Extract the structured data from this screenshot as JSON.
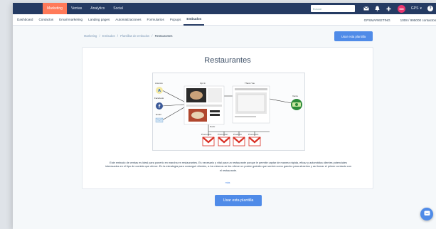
{
  "topnav": {
    "items": [
      "Marketing",
      "Ventas",
      "Analytics",
      "Social"
    ],
    "search_placeholder": "Buscar",
    "avatar_initials": "GM",
    "account_label": "GPS",
    "account_caret": "▾",
    "help_label": "?"
  },
  "subnav": {
    "items": [
      "Dashboard",
      "Contactos",
      "Email marketing",
      "Landing pages",
      "Automatizaciones",
      "Formularios",
      "Popups",
      "Embudos"
    ],
    "account_name": "GPSMARKETING",
    "contacts_count": "1008 / 995000 contactos"
  },
  "breadcrumb": {
    "items": [
      "Marketing",
      "Embudos",
      "Plantillas de embudos"
    ],
    "separator": "/",
    "current": "Restaurantes"
  },
  "use_template_top_label": "Usar esta plantilla",
  "page_title": "Restaurantes",
  "diagram": {
    "source_labels": [
      "Anuncio",
      "Facebook",
      "Email"
    ],
    "optin_label": "Opt In",
    "thankyou_label": "Thank You",
    "sale_label": "Venta",
    "nurture_label": "Nutrir",
    "email_labels": [
      "Promoción",
      "Promoción",
      "Producto",
      "Promoción"
    ]
  },
  "description": "Este embudo de ventas es ideal para ponerlo en marcha en restaurantes. Es necesario y vital para un restaurante porque le permite captar de manera rápida, eficaz y automática clientes potenciales interesados en el tipo de comida que ofrece. En la estrategia para conseguir clientes, a los mismos se les ofrece un postre gratuito que servirá como gancho para atraerlos y así tomar el primer contacto con el restaurante.",
  "more_link": "más",
  "use_template_main_label": "Usar esta plantilla",
  "colors": {
    "nav": "#253b63",
    "accent": "#ff7a59",
    "primary": "#4f8be8",
    "email_red": "#d93025",
    "sale_green": "#2e8b3a"
  }
}
